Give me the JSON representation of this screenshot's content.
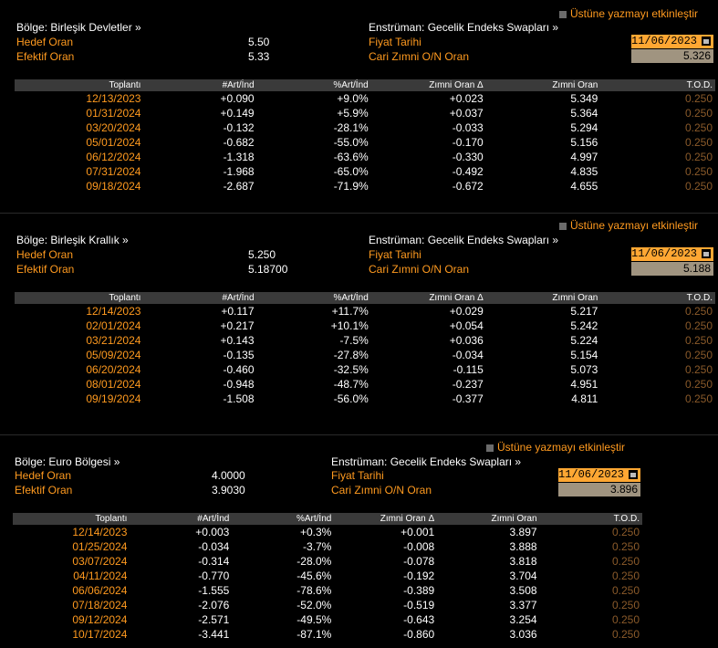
{
  "overwrite_label": "Üstüne yazmayı etkinleştir",
  "columns": [
    "Toplantı",
    "#Art/İnd",
    "%Art/İnd",
    "Zımni Oran Δ",
    "Zımni Oran",
    "T.O.D."
  ],
  "panels": [
    {
      "region": "Bölge: Birleşik Devletler »",
      "instrument": "Enstrüman: Gecelik Endeks Swapları »",
      "target_label": "Hedef Oran",
      "target_value": "5.50",
      "effective_label": "Efektif Oran",
      "effective_value": "5.33",
      "price_date_label": "Fiyat Tarihi",
      "price_date_value": "11/06/2023",
      "implied_on_label": "Cari Zımni O/N Oran",
      "implied_on_value": "5.326",
      "rows": [
        [
          "12/13/2023",
          "+0.090",
          "+9.0%",
          "+0.023",
          "5.349",
          "0.250"
        ],
        [
          "01/31/2024",
          "+0.149",
          "+5.9%",
          "+0.037",
          "5.364",
          "0.250"
        ],
        [
          "03/20/2024",
          "-0.132",
          "-28.1%",
          "-0.033",
          "5.294",
          "0.250"
        ],
        [
          "05/01/2024",
          "-0.682",
          "-55.0%",
          "-0.170",
          "5.156",
          "0.250"
        ],
        [
          "06/12/2024",
          "-1.318",
          "-63.6%",
          "-0.330",
          "4.997",
          "0.250"
        ],
        [
          "07/31/2024",
          "-1.968",
          "-65.0%",
          "-0.492",
          "4.835",
          "0.250"
        ],
        [
          "09/18/2024",
          "-2.687",
          "-71.9%",
          "-0.672",
          "4.655",
          "0.250"
        ]
      ]
    },
    {
      "region": "Bölge: Birleşik Krallık »",
      "instrument": "Enstrüman: Gecelik Endeks Swapları »",
      "target_label": "Hedef Oran",
      "target_value": "5.250",
      "effective_label": "Efektif Oran",
      "effective_value": "5.18700",
      "price_date_label": "Fiyat Tarihi",
      "price_date_value": "11/06/2023",
      "implied_on_label": "Cari Zımni O/N Oran",
      "implied_on_value": "5.188",
      "rows": [
        [
          "12/14/2023",
          "+0.117",
          "+11.7%",
          "+0.029",
          "5.217",
          "0.250"
        ],
        [
          "02/01/2024",
          "+0.217",
          "+10.1%",
          "+0.054",
          "5.242",
          "0.250"
        ],
        [
          "03/21/2024",
          "+0.143",
          "-7.5%",
          "+0.036",
          "5.224",
          "0.250"
        ],
        [
          "05/09/2024",
          "-0.135",
          "-27.8%",
          "-0.034",
          "5.154",
          "0.250"
        ],
        [
          "06/20/2024",
          "-0.460",
          "-32.5%",
          "-0.115",
          "5.073",
          "0.250"
        ],
        [
          "08/01/2024",
          "-0.948",
          "-48.7%",
          "-0.237",
          "4.951",
          "0.250"
        ],
        [
          "09/19/2024",
          "-1.508",
          "-56.0%",
          "-0.377",
          "4.811",
          "0.250"
        ]
      ]
    },
    {
      "region": "Bölge: Euro Bölgesi »",
      "instrument": "Enstrüman: Gecelik Endeks Swapları »",
      "target_label": "Hedef Oran",
      "target_value": "4.0000",
      "effective_label": "Efektif Oran",
      "effective_value": "3.9030",
      "price_date_label": "Fiyat Tarihi",
      "price_date_value": "11/06/2023",
      "implied_on_label": "Cari Zımni O/N Oran",
      "implied_on_value": "3.896",
      "rows": [
        [
          "12/14/2023",
          "+0.003",
          "+0.3%",
          "+0.001",
          "3.897",
          "0.250"
        ],
        [
          "01/25/2024",
          "-0.034",
          "-3.7%",
          "-0.008",
          "3.888",
          "0.250"
        ],
        [
          "03/07/2024",
          "-0.314",
          "-28.0%",
          "-0.078",
          "3.818",
          "0.250"
        ],
        [
          "04/11/2024",
          "-0.770",
          "-45.6%",
          "-0.192",
          "3.704",
          "0.250"
        ],
        [
          "06/06/2024",
          "-1.555",
          "-78.6%",
          "-0.389",
          "3.508",
          "0.250"
        ],
        [
          "07/18/2024",
          "-2.076",
          "-52.0%",
          "-0.519",
          "3.377",
          "0.250"
        ],
        [
          "09/12/2024",
          "-2.571",
          "-49.5%",
          "-0.643",
          "3.254",
          "0.250"
        ],
        [
          "10/17/2024",
          "-3.441",
          "-87.1%",
          "-0.860",
          "3.036",
          "0.250"
        ]
      ]
    }
  ]
}
